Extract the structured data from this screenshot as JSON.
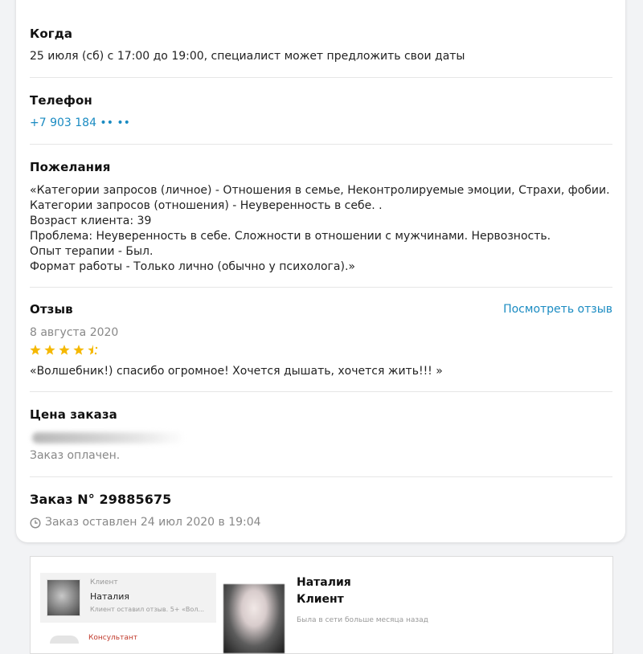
{
  "when": {
    "label": "Когда",
    "value": "25 июля (сб) с 17:00 до 19:00, специалист может предложить свои даты"
  },
  "phone": {
    "label": "Телефон",
    "value": "+7 903 184 •• ••"
  },
  "wishes": {
    "label": "Пожелания",
    "lines": [
      "«Категории запросов (личное) - Отношения в семье, Неконтролируемые эмоции, Страхи, фобии.",
      "Категории запросов (отношения) - Неуверенность в себе. .",
      "Возраст клиента: 39",
      "Проблема: Неуверенность в себе. Сложности в отношении с мужчинами. Нервозность.",
      "Опыт терапии - Был.",
      "Формат работы - Только лично (обычно у психолога).»"
    ]
  },
  "review": {
    "label": "Отзыв",
    "link": "Посмотреть отзыв",
    "date": "8 августа 2020",
    "rating": 4.5,
    "rating_max": 5,
    "star_color": "#f5b800",
    "text": "«Волшебник!) спасибо огромное! Хочется дышать, хочется жить!!! »"
  },
  "price": {
    "label": "Цена заказа",
    "status": "Заказ оплачен."
  },
  "order": {
    "title": "Заказ N° 29885675",
    "placed": "Заказ оставлен 24 июл 2020 в 19:04",
    "placed_icon": "clock-icon"
  },
  "chat": {
    "dialog": {
      "role": "Клиент",
      "name": "Наталия",
      "preview": "Клиент оставил отзыв. 5+ «Вол..."
    },
    "next_dialog": {
      "role": "Консультант",
      "role_color": "#c0392b"
    },
    "profile": {
      "name": "Наталия",
      "role": "Клиент",
      "status": "Была в сети больше месяца назад"
    }
  }
}
